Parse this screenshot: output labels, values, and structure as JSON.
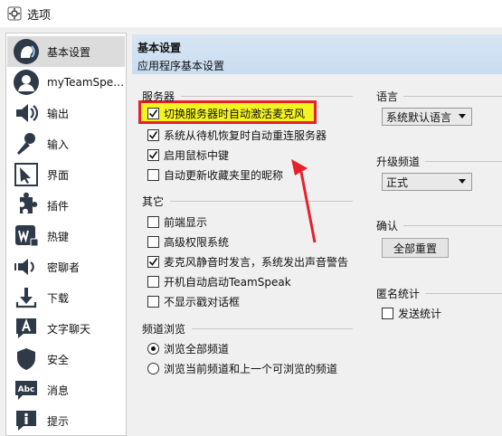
{
  "window": {
    "title": "选项"
  },
  "sidebar": {
    "items": [
      {
        "label": "基本设置",
        "icon": "speaker-head-icon",
        "selected": true
      },
      {
        "label": "myTeamSpe…",
        "icon": "person-icon",
        "selected": false
      },
      {
        "label": "输出",
        "icon": "speaker-icon",
        "selected": false
      },
      {
        "label": "输入",
        "icon": "microphone-icon",
        "selected": false
      },
      {
        "label": "界面",
        "icon": "cursor-icon",
        "selected": false
      },
      {
        "label": "插件",
        "icon": "puzzle-icon",
        "selected": false
      },
      {
        "label": "热键",
        "icon": "keyboard-w-icon",
        "selected": false
      },
      {
        "label": "密聊者",
        "icon": "whisper-speaker-icon",
        "selected": false
      },
      {
        "label": "下载",
        "icon": "download-icon",
        "selected": false
      },
      {
        "label": "文字聊天",
        "icon": "chat-a-icon",
        "selected": false
      },
      {
        "label": "安全",
        "icon": "shield-icon",
        "selected": false
      },
      {
        "label": "消息",
        "icon": "abc-bubble-icon",
        "selected": false
      },
      {
        "label": "提示",
        "icon": "info-icon",
        "selected": false
      }
    ]
  },
  "header": {
    "title": "基本设置",
    "subtitle": "应用程序基本设置"
  },
  "groups": {
    "server": {
      "title": "服务器",
      "options": [
        {
          "label": "切换服务器时自动激活麦克风",
          "checked": true
        },
        {
          "label": "系统从待机恢复时自动重连服务器",
          "checked": true
        },
        {
          "label": "启用鼠标中键",
          "checked": true
        },
        {
          "label": "自动更新收藏夹里的昵称",
          "checked": false
        }
      ]
    },
    "other": {
      "title": "其它",
      "options": [
        {
          "label": "前端显示",
          "checked": false
        },
        {
          "label": "高级权限系统",
          "checked": false
        },
        {
          "label": "麦克风静音时发言，系统发出声音警告",
          "checked": true
        },
        {
          "label": "开机自动启动TeamSpeak",
          "checked": false
        },
        {
          "label": "不显示戳对话框",
          "checked": false
        }
      ]
    },
    "browse": {
      "title": "频道浏览",
      "options": [
        {
          "label": "浏览全部频道",
          "selected": true
        },
        {
          "label": "浏览当前频道和上一个可浏览的频道",
          "selected": false
        }
      ]
    },
    "language": {
      "title": "语言",
      "value": "系统默认语言"
    },
    "update": {
      "title": "升级频道",
      "value": "正式"
    },
    "confirm": {
      "title": "确认",
      "button": "全部重置"
    },
    "stats": {
      "title": "匿名统计",
      "option": {
        "label": "发送统计",
        "checked": false
      }
    }
  },
  "colors": {
    "highlight_border": "#e8202a",
    "highlight_fill": "#f4f420",
    "annotation_arrow": "#e8202a",
    "header_blue": "#cfe0f2"
  }
}
